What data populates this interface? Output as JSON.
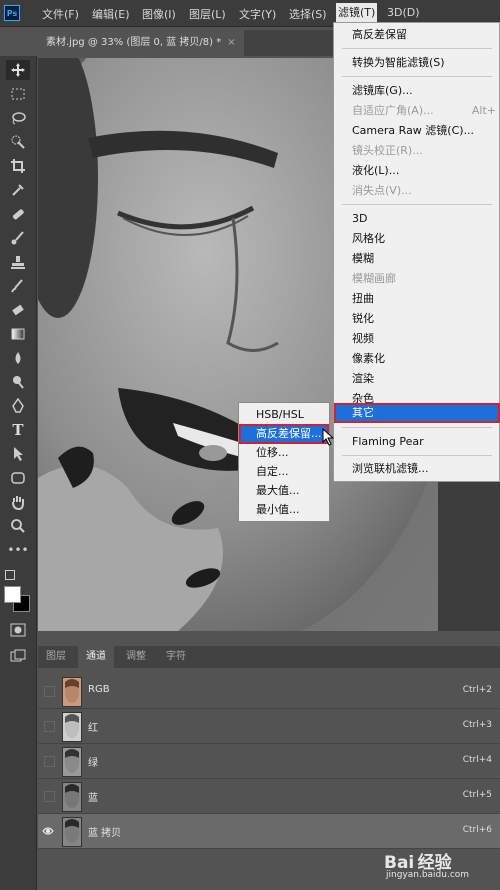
{
  "menubar": {
    "app_logo": "Ps",
    "items": [
      "文件(F)",
      "编辑(E)",
      "图像(I)",
      "图层(L)",
      "文字(Y)",
      "选择(S)",
      "滤镜(T)",
      "3D(D)"
    ],
    "active_index": 6
  },
  "document_tab": {
    "title": "素材.jpg @ 33% (图层 0, 蓝 拷贝/8) *",
    "close": "×"
  },
  "filter_menu": {
    "items": [
      {
        "label": "高反差保留",
        "shortcut": "",
        "disabled": false
      },
      {
        "label": "转换为智能滤镜(S)",
        "shortcut": "",
        "disabled": false
      },
      {
        "label": "滤镜库(G)...",
        "shortcut": "",
        "disabled": false
      },
      {
        "label": "自适应广角(A)...",
        "shortcut": "Alt+",
        "disabled": true
      },
      {
        "label": "Camera Raw 滤镜(C)...",
        "shortcut": "",
        "disabled": false
      },
      {
        "label": "镜头校正(R)...",
        "shortcut": "",
        "disabled": true
      },
      {
        "label": "液化(L)...",
        "shortcut": "",
        "disabled": false
      },
      {
        "label": "消失点(V)...",
        "shortcut": "",
        "disabled": true
      },
      {
        "label": "3D",
        "shortcut": "",
        "disabled": false
      },
      {
        "label": "风格化",
        "shortcut": "",
        "disabled": false
      },
      {
        "label": "模糊",
        "shortcut": "",
        "disabled": false
      },
      {
        "label": "模糊画廊",
        "shortcut": "",
        "disabled": true
      },
      {
        "label": "扭曲",
        "shortcut": "",
        "disabled": false
      },
      {
        "label": "锐化",
        "shortcut": "",
        "disabled": false
      },
      {
        "label": "视频",
        "shortcut": "",
        "disabled": false
      },
      {
        "label": "像素化",
        "shortcut": "",
        "disabled": false
      },
      {
        "label": "渲染",
        "shortcut": "",
        "disabled": false
      },
      {
        "label": "杂色",
        "shortcut": "",
        "disabled": false
      },
      {
        "label": "其它",
        "shortcut": "",
        "disabled": false,
        "highlighted": true
      },
      {
        "label": "Flaming Pear",
        "shortcut": "",
        "disabled": false
      },
      {
        "label": "浏览联机滤镜...",
        "shortcut": "",
        "disabled": false
      }
    ]
  },
  "other_submenu": {
    "items": [
      {
        "label": "HSB/HSL"
      },
      {
        "label": "高反差保留...",
        "highlighted": true
      },
      {
        "label": "位移..."
      },
      {
        "label": "自定..."
      },
      {
        "label": "最大值..."
      },
      {
        "label": "最小值..."
      }
    ]
  },
  "panel": {
    "tabs": [
      "图层",
      "通道",
      "调整",
      "字符"
    ],
    "active_tab": 1,
    "channels": [
      {
        "name": "RGB",
        "shortcut": "Ctrl+2",
        "visible": false,
        "selected": false,
        "color_thumb": true
      },
      {
        "name": "红",
        "shortcut": "Ctrl+3",
        "visible": false,
        "selected": false
      },
      {
        "name": "绿",
        "shortcut": "Ctrl+4",
        "visible": false,
        "selected": false
      },
      {
        "name": "蓝",
        "shortcut": "Ctrl+5",
        "visible": false,
        "selected": false
      },
      {
        "name": "蓝 拷贝",
        "shortcut": "Ctrl+6",
        "visible": true,
        "selected": true
      }
    ]
  },
  "tools": [
    "move-icon",
    "marquee-icon",
    "lasso-icon",
    "quick-select-icon",
    "crop-icon",
    "eyedropper-icon",
    "healing-icon",
    "brush-icon",
    "stamp-icon",
    "history-brush-icon",
    "eraser-icon",
    "gradient-icon",
    "blur-icon",
    "dodge-icon",
    "pen-icon",
    "type-icon",
    "path-select-icon",
    "shape-icon",
    "hand-icon",
    "zoom-icon",
    "more-icon"
  ],
  "watermark": {
    "brand": "Bai 经验",
    "url": "jingyan.baidu.com"
  },
  "colors": {
    "highlight": "#1e6fd9",
    "highlight_outline": "#d2222d",
    "menu_bg": "#f0f0f0",
    "ui_dark": "#3c3c3c"
  }
}
